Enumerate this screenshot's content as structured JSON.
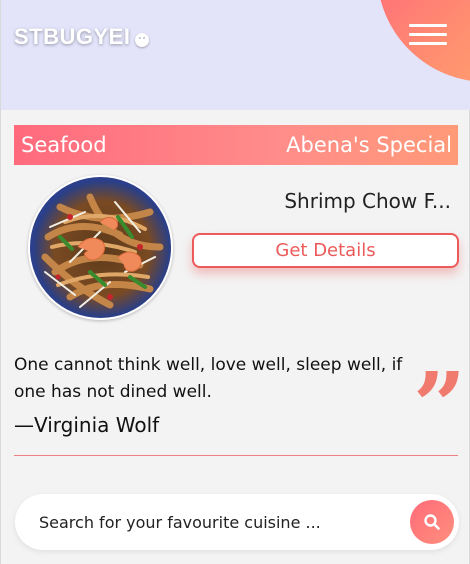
{
  "header": {
    "brand": "STBUGYEI",
    "brand_icon": "smiley-icon",
    "menu_icon": "hamburger-menu-icon"
  },
  "banner": {
    "category": "Seafood",
    "special": "Abena's Special"
  },
  "dish": {
    "name": "Shrimp Chow F...",
    "image_icon": "shrimp-chow-fun-photo",
    "details_label": "Get Details"
  },
  "quote": {
    "text": "One cannot think well, love well, sleep well, if one has not dined well.",
    "author": "—Virginia Wolf",
    "icon": "closing-quote-icon"
  },
  "search": {
    "placeholder": "Search for your favourite cuisine ...",
    "value": "",
    "icon": "search-icon"
  },
  "colors": {
    "header_bg": "#e3e3fa",
    "accent": "#ff6b7a",
    "accent_secondary": "#ff8f70",
    "button_text": "#ec5a5a",
    "page_bg": "#f3f3f3"
  }
}
